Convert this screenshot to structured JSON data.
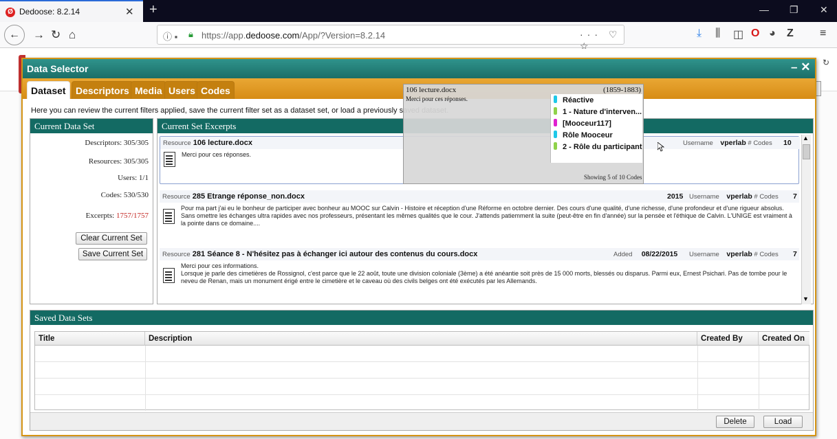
{
  "browser": {
    "tab_title": "Dedoose: 8.2.14",
    "url_prefix": "https://app.",
    "url_host": "dedoose.com",
    "url_path": "/App/?Version=8.2.14"
  },
  "dialog": {
    "title": "Data Selector",
    "tabs": [
      "Dataset",
      "Descriptors",
      "Media",
      "Users",
      "Codes"
    ],
    "active_tab": "Dataset",
    "description": "Here you can review the current filters applied, save the current filter set as a dataset set, or load a previously saved dataset."
  },
  "current_set": {
    "title": "Current Data Set",
    "descriptors": "Descriptors: 305/305",
    "resources": "Resources: 305/305",
    "users": "Users: 1/1",
    "codes": "Codes: 530/530",
    "excerpts_label": "Excerpts:",
    "excerpts_value": "1757/1757",
    "clear_button": "Clear Current Set",
    "save_button": "Save Current Set"
  },
  "excerpts": {
    "title": "Current Set Excerpts",
    "resource_label": "Resource",
    "added_label": "Added",
    "username_label": "Username",
    "codes_label": "# Codes",
    "items": [
      {
        "resource": "106 lecture.docx",
        "text": "Merci pour ces réponses.",
        "added": "",
        "username": "vperlab",
        "codes": "10"
      },
      {
        "resource": "285 Etrange réponse_non.docx",
        "text": "Pour ma part j'ai eu le bonheur de participer avec bonheur au MOOC sur Calvin - Histoire et réception d'une Réforme en octobre dernier. Des cours d'une qualité, d'une richesse, d'une profondeur et d'une rigueur absolus. Sans omettre les échanges ultra rapides avec nos professeurs, présentant les mêmes qualités que le cour. J'attends patiemment la suite (peut-être en fin d'année) sur la pensée et l'éthique de Calvin. L'UNIGE est vraiment à la pointe dans ce domaine....",
        "added": "2015",
        "username": "vperlab",
        "codes": "7"
      },
      {
        "resource": "281 Séance 8 - N'hésitez pas à échanger ici autour des contenus du cours.docx",
        "text": "Merci pour ces informations.\nLorsque je parle des cimetières de Rossignol, c'est parce que le 22 août, toute une division coloniale (3ème) a été anéantie soit près de 15 000 morts, blessés ou disparus. Parmi eux, Ernest Psichari. Pas de tombe pour le neveu de Renan, mais un monument érigé entre le cimetière et le caveau où des civils belges ont été exécutés par les Allemands.",
        "added": "08/22/2015",
        "username": "vperlab",
        "codes": "7"
      }
    ]
  },
  "popup": {
    "filename": "106 lecture.docx",
    "pages": "(1859-1883)",
    "text": "Merci pour ces réponses.",
    "codes": [
      {
        "label": "Réactive",
        "color": "#1ec8e8"
      },
      {
        "label": "1 - Nature d'interven...",
        "color": "#8fd24a"
      },
      {
        "label": "[Mooceur117]",
        "color": "#e020d0"
      },
      {
        "label": "Rôle Mooceur",
        "color": "#1ec8e8"
      },
      {
        "label": "2 - Rôle du participant",
        "color": "#8fd24a"
      }
    ],
    "footer": "Showing 5 of 10 Codes"
  },
  "saved": {
    "title": "Saved Data Sets",
    "columns": [
      "Title",
      "Description",
      "Created By",
      "Created On"
    ],
    "delete_button": "Delete",
    "load_button": "Load"
  },
  "colors": {
    "teal": "#136a63",
    "orange": "#d78c15",
    "excerpt_count": "#c0201c"
  }
}
